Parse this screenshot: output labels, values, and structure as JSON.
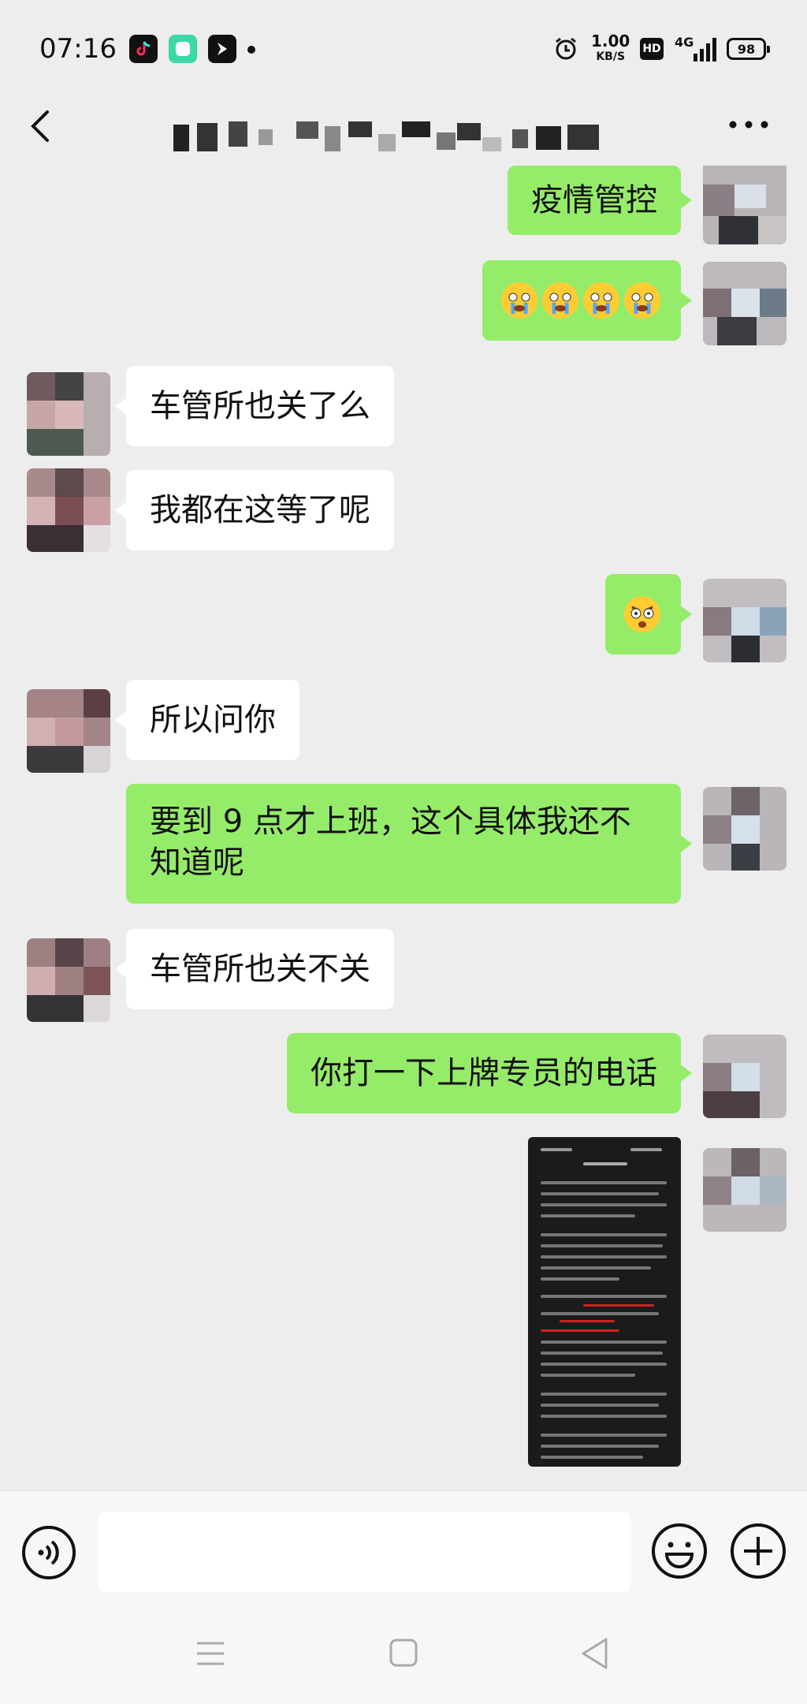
{
  "status_bar": {
    "time": "07:16",
    "net_speed_value": "1.00",
    "net_speed_unit": "KB/S",
    "hd_badge": "HD",
    "network_type": "4G",
    "battery_level": "98",
    "app_icons": [
      "tiktok-icon",
      "rounded-square-app-icon",
      "bird-app-icon"
    ]
  },
  "nav": {
    "back_icon": "chevron-left-icon",
    "title": "(redacted contact name)",
    "more_icon": "more-dots-icon"
  },
  "messages": [
    {
      "sender": "me",
      "type": "text",
      "text": "疫情管控"
    },
    {
      "sender": "me",
      "type": "emoji",
      "emoji": [
        "crying-face",
        "crying-face",
        "crying-face",
        "crying-face"
      ]
    },
    {
      "sender": "them",
      "type": "text",
      "text": "车管所也关了么"
    },
    {
      "sender": "them",
      "type": "text",
      "text": "我都在这等了呢"
    },
    {
      "sender": "me",
      "type": "emoji",
      "emoji": [
        "shocked-face"
      ]
    },
    {
      "sender": "them",
      "type": "text",
      "text": "所以问你"
    },
    {
      "sender": "me",
      "type": "text",
      "line1": "要到 9 点才上班，这个具体我还不",
      "line2": "知道呢"
    },
    {
      "sender": "them",
      "type": "text",
      "text": "车管所也关不关"
    },
    {
      "sender": "me",
      "type": "text",
      "text": "你打一下上牌专员的电话"
    },
    {
      "sender": "me",
      "type": "image",
      "image": "document-screenshot-thumbnail"
    }
  ],
  "input_bar": {
    "voice_icon": "voice-input-icon",
    "input_value": "",
    "emoji_icon": "smiley-icon",
    "plus_icon": "plus-circle-icon"
  },
  "system_nav": {
    "icons": [
      "menu-lines-icon",
      "home-square-icon",
      "back-triangle-icon"
    ]
  },
  "colors": {
    "background": "#ededed",
    "my_bubble": "#95ec69",
    "their_bubble": "#ffffff",
    "bar": "#f7f7f7"
  }
}
